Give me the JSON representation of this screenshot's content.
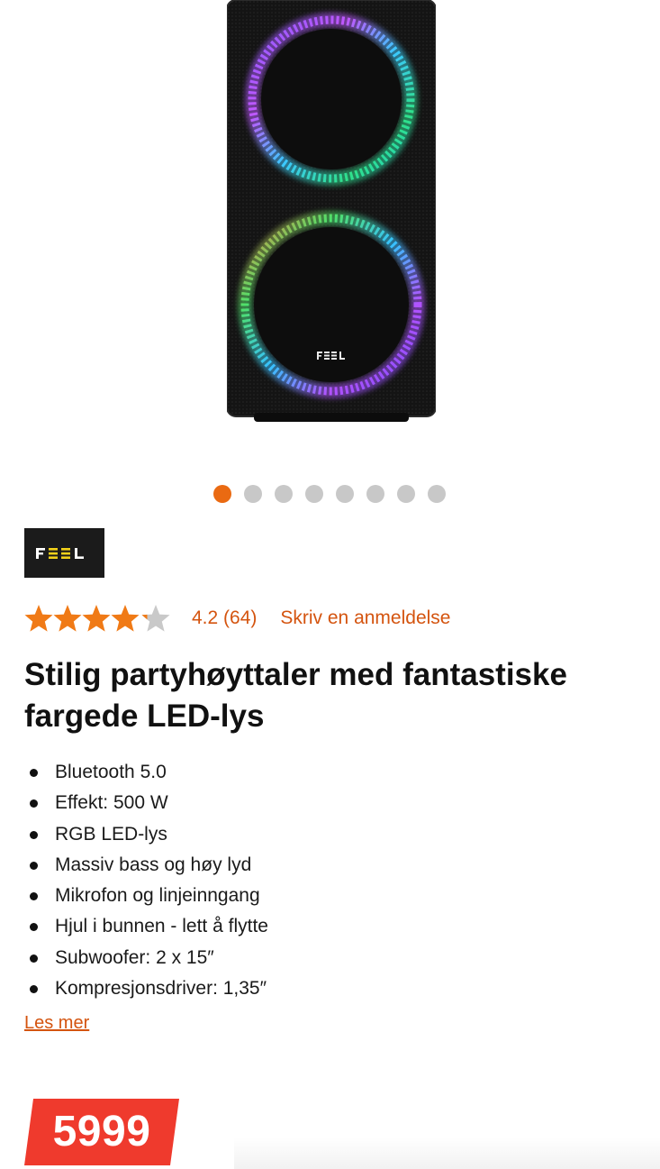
{
  "gallery": {
    "slide_count": 8,
    "active_slide": 0
  },
  "brand": {
    "name": "FEEL"
  },
  "rating": {
    "score": 4.2,
    "max": 5,
    "text": "4.2 (64)",
    "review_link": "Skriv en anmeldelse",
    "star_color": "#f07a16"
  },
  "product": {
    "title": "Stilig partyhøyttaler med fantastiske fargede LED-lys",
    "features": [
      "Bluetooth 5.0",
      "Effekt: 500 W",
      "RGB LED-lys",
      "Massiv bass og høy lyd",
      "Mikrofon og linjeinngang",
      "Hjul i bunnen - lett å flytte",
      "Subwoofer: 2 x 15″",
      "Kompresjonsdriver: 1,35″"
    ],
    "read_more": "Les mer"
  },
  "price": {
    "value": "5999",
    "tag_color": "#ef3a2d"
  },
  "colors": {
    "accent": "#ea6a12",
    "link": "#d4540f"
  }
}
